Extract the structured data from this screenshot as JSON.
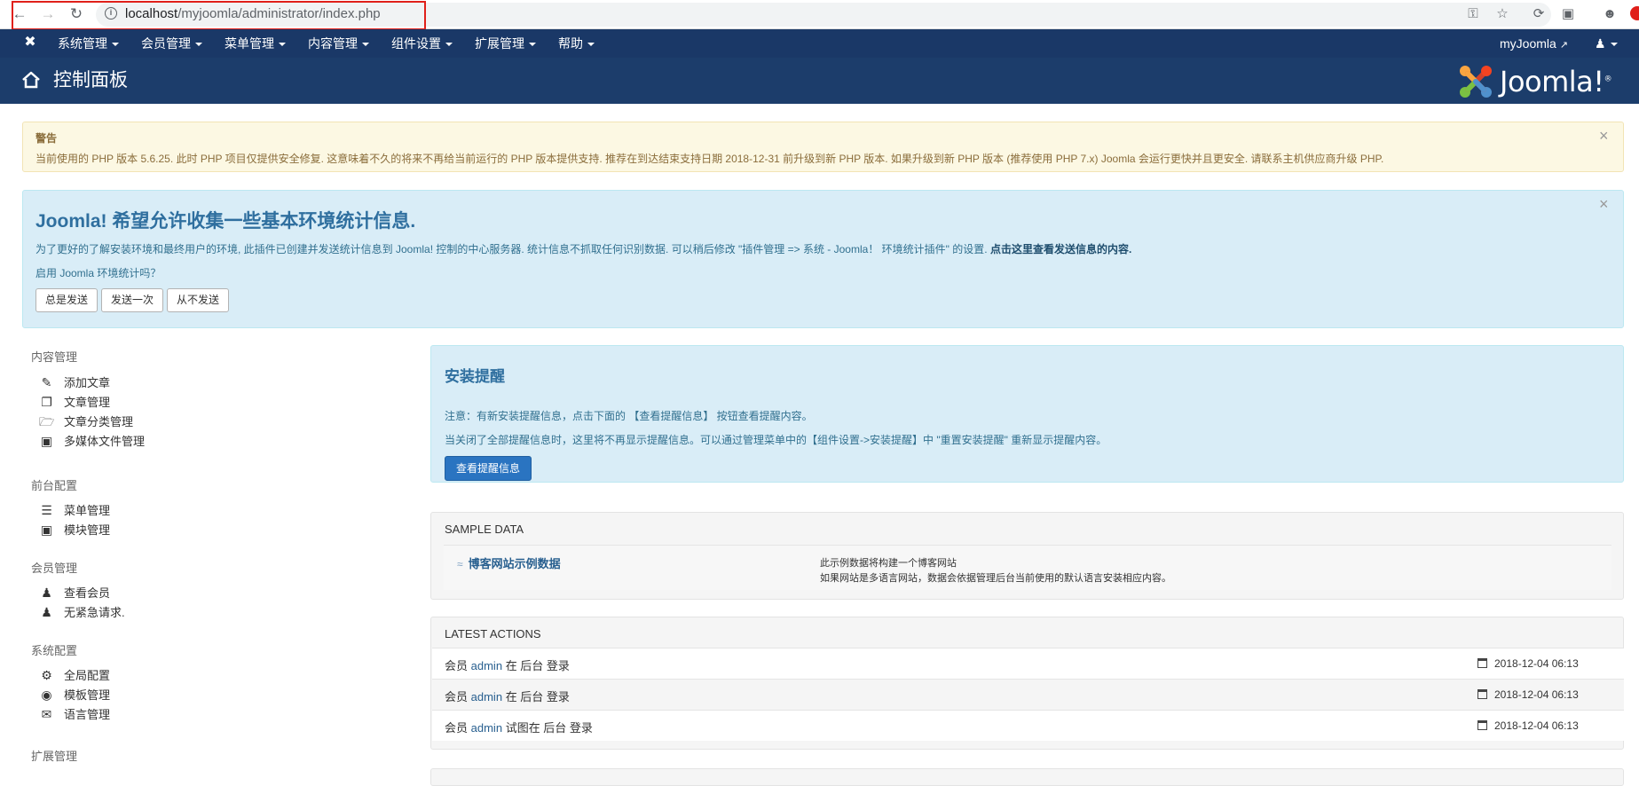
{
  "browser": {
    "url_host": "localhost",
    "url_path": "/myjoomla/administrator/index.php"
  },
  "admin_menu": {
    "items": [
      "系统管理",
      "会员管理",
      "菜单管理",
      "内容管理",
      "组件设置",
      "扩展管理",
      "帮助"
    ],
    "site_link": "myJoomla"
  },
  "header": {
    "title": "控制面板",
    "logo_text": "Joomla!",
    "logo_mark": "®"
  },
  "warning": {
    "title": "警告",
    "text": "当前使用的 PHP 版本 5.6.25. 此时 PHP 项目仅提供安全修复. 这意味着不久的将来不再给当前运行的 PHP 版本提供支持. 推荐在到达结束支持日期 2018-12-31 前升级到新 PHP 版本. 如果升级到新 PHP 版本 (推荐使用 PHP 7.x) Joomla 会运行更快并且更安全. 请联系主机供应商升级 PHP."
  },
  "stats": {
    "title": "Joomla! 希望允许收集一些基本环境统计信息.",
    "text": "为了更好的了解安装环境和最终用户的环境, 此插件已创建并发送统计信息到 Joomla! 控制的中心服务器. 统计信息不抓取任何识别数据. 可以稍后修改 \"插件管理 => 系统 - Joomla！ 环境统计插件\" 的设置.",
    "text_bold": "点击这里查看发送信息的内容.",
    "question": "启用 Joomla 环境统计吗？",
    "btn_always": "总是发送",
    "btn_once": "发送一次",
    "btn_never": "从不发送"
  },
  "sidebar": {
    "sections": [
      {
        "title": "内容管理",
        "items": [
          {
            "label": "添加文章",
            "icon": "pencil-icon"
          },
          {
            "label": "文章管理",
            "icon": "copy-icon"
          },
          {
            "label": "文章分类管理",
            "icon": "folder-icon"
          },
          {
            "label": "多媒体文件管理",
            "icon": "image-icon"
          }
        ]
      },
      {
        "title": "前台配置",
        "items": [
          {
            "label": "菜单管理",
            "icon": "list-icon"
          },
          {
            "label": "模块管理",
            "icon": "cube-icon"
          }
        ]
      },
      {
        "title": "会员管理",
        "items": [
          {
            "label": "查看会员",
            "icon": "users-icon"
          },
          {
            "label": "无紧急请求.",
            "icon": "users-icon"
          }
        ]
      },
      {
        "title": "系统配置",
        "items": [
          {
            "label": "全局配置",
            "icon": "cog-icon"
          },
          {
            "label": "模板管理",
            "icon": "eye-icon"
          },
          {
            "label": "语言管理",
            "icon": "comments-icon"
          }
        ]
      },
      {
        "title": "扩展管理",
        "items": []
      }
    ]
  },
  "install": {
    "title": "安装提醒",
    "line1": "注意：有新安装提醒信息，点击下面的 【查看提醒信息】 按钮查看提醒内容。",
    "line2": "当关闭了全部提醒信息时，这里将不再显示提醒信息。可以通过管理菜单中的【组件设置->安装提醒】中 \"重置安装提醒\" 重新显示提醒内容。",
    "button": "查看提醒信息"
  },
  "sample_data": {
    "heading": "SAMPLE DATA",
    "link": "博客网站示例数据",
    "desc1": "此示例数据将构建一个博客网站",
    "desc2": "如果网站是多语言网站，数据会依据管理后台当前使用的默认语言安装相应内容。"
  },
  "latest_actions": {
    "heading": "LATEST ACTIONS",
    "rows": [
      {
        "pre": "会员",
        "user": "admin",
        "post": "在 后台 登录",
        "date": "2018-12-04 06:13"
      },
      {
        "pre": "会员",
        "user": "admin",
        "post": "在 后台 登录",
        "date": "2018-12-04 06:13"
      },
      {
        "pre": "会员",
        "user": "admin",
        "post": "试图在 后台 登录",
        "date": "2018-12-04 06:13"
      }
    ]
  },
  "colors": {
    "admin_bar": "#1a3867",
    "header": "#1c3d6b",
    "warning_bg": "#fcf8e3",
    "info_bg": "#d9edf7",
    "primary_button": "#2a74c1"
  }
}
